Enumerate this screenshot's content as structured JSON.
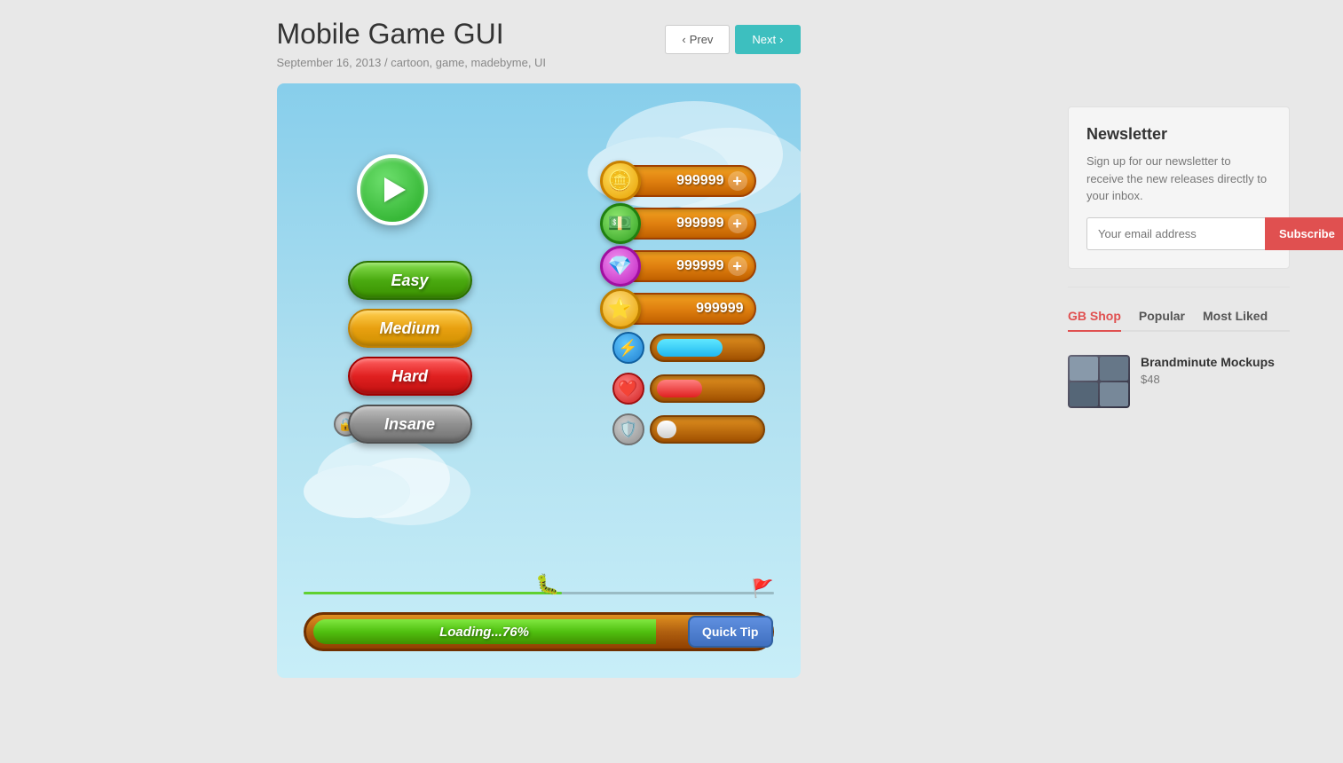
{
  "post": {
    "title": "Mobile Game GUI",
    "date": "September 16, 2013",
    "separator": "/",
    "tags": "cartoon, game, madebyme, UI"
  },
  "nav": {
    "prev_label": "Prev",
    "next_label": "Next"
  },
  "game": {
    "play_button_label": "Play",
    "difficulties": [
      {
        "label": "Easy",
        "style": "easy"
      },
      {
        "label": "Medium",
        "style": "medium"
      },
      {
        "label": "Hard",
        "style": "hard"
      },
      {
        "label": "Insane",
        "style": "insane"
      }
    ],
    "resources": [
      {
        "icon": "🪙",
        "value": "999999",
        "has_plus": true,
        "type": "coin"
      },
      {
        "icon": "💵",
        "value": "999999",
        "has_plus": true,
        "type": "cash"
      },
      {
        "icon": "💎",
        "value": "999999",
        "has_plus": true,
        "type": "gem"
      },
      {
        "icon": "⭐",
        "value": "999999",
        "has_plus": false,
        "type": "star"
      }
    ],
    "progress_bars": [
      {
        "icon": "⚡",
        "fill": 65,
        "color": "blue"
      },
      {
        "icon": "❤️",
        "fill": 45,
        "color": "red"
      },
      {
        "icon": "🛡️",
        "fill": 20,
        "color": "white"
      }
    ],
    "loading": {
      "text": "Loading...76%",
      "percent": 76
    },
    "quick_tip_label": "Quick Tip"
  },
  "newsletter": {
    "title": "Newsletter",
    "description": "Sign up for our newsletter to receive the new releases directly to your inbox.",
    "input_placeholder": "Your email address",
    "subscribe_label": "Subscribe"
  },
  "tabs": [
    {
      "label": "GB Shop",
      "active": true
    },
    {
      "label": "Popular",
      "active": false
    },
    {
      "label": "Most Liked",
      "active": false
    }
  ],
  "shop_items": [
    {
      "name": "Brandminute Mockups",
      "price": "$48"
    }
  ]
}
